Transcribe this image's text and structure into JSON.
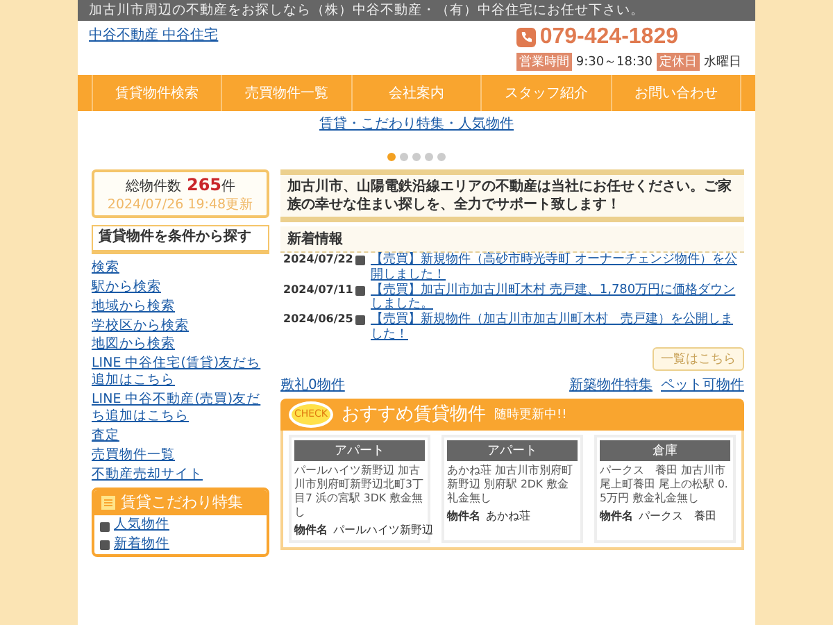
{
  "top_bar": {
    "text": "加古川市周辺の不動産をお探しなら（株）中谷不動産・（有）中谷住宅にお任せ下さい。"
  },
  "header": {
    "logo_alt": "中谷不動産 中谷住宅",
    "phone": "079-424-1829",
    "hours_label": "営業時間",
    "hours": "9:30～18:30",
    "holiday_label": "定休日",
    "holiday": "水曜日"
  },
  "nav": [
    {
      "label": "賃貸物件検索"
    },
    {
      "label": "売買物件一覧"
    },
    {
      "label": "会社案内"
    },
    {
      "label": "スタッフ紹介"
    },
    {
      "label": "お問い合わせ"
    }
  ],
  "slider": {
    "caption": "賃貸・こだわり特集・人気物件",
    "dots": [
      {
        "selected": true
      },
      {
        "selected": false
      },
      {
        "selected": false
      },
      {
        "selected": false
      },
      {
        "selected": false
      }
    ]
  },
  "stats": {
    "label": "総物件数",
    "count": "265",
    "unit": "件",
    "updated": "2024/07/26 19:48更新"
  },
  "search": {
    "title": "賃貸物件を条件から探す",
    "links": [
      "検索",
      "駅から検索",
      "地域から検索",
      "学校区から検索",
      "地図から検索"
    ]
  },
  "side_links": [
    "LINE 中谷住宅(賃貸)友だち追加はこちら",
    "LINE 中谷不動産(売買)友だち追加はこちら",
    "査定",
    "売買物件一覧",
    "不動産売却サイト"
  ],
  "feature": {
    "title": "賃貸こだわり特集",
    "items": [
      "人気物件",
      "新着物件"
    ]
  },
  "intro": "加古川市、山陽電鉄沿線エリアの不動産は当社にお任せください。ご家族の幸せな住まい探しを、全力でサポート致します！",
  "news": {
    "title": "新着情報",
    "items": [
      {
        "date": "2024/07/22",
        "text": "【売買】新規物件（高砂市時光寺町 オーナーチェンジ物件）を公開しました！"
      },
      {
        "date": "2024/07/11",
        "text": "【売買】加古川市加古川町木村 売戸建、1,780万円に価格ダウンしました。"
      },
      {
        "date": "2024/06/25",
        "text": "【売買】新規物件（加古川市加古川町木村　売戸建）を公開しました！"
      }
    ],
    "more": "一覧はこちら"
  },
  "banners": [
    "敷礼0物件",
    "新築物件特集",
    "ペット可物件"
  ],
  "recommend": {
    "badge": "CHECK",
    "title": "おすすめ賃貸物件",
    "subtitle": "随時更新中!!",
    "cards": [
      {
        "category": "アパート",
        "image_alt": "パールハイツ新野辺 加古川市別府町新野辺北町3丁目7 浜の宮駅 3DK 敷金無し",
        "name_label": "物件名",
        "name": "パールハイツ新野辺"
      },
      {
        "category": "アパート",
        "image_alt": "あかね荘 加古川市別府町新野辺 別府駅 2DK 敷金礼金無し",
        "name_label": "物件名",
        "name": "あかね荘"
      },
      {
        "category": "倉庫",
        "image_alt": "パークス　養田 加古川市尾上町養田 尾上の松駅 0.5万円 敷金礼金無し",
        "name_label": "物件名",
        "name": "パークス　養田"
      }
    ]
  }
}
